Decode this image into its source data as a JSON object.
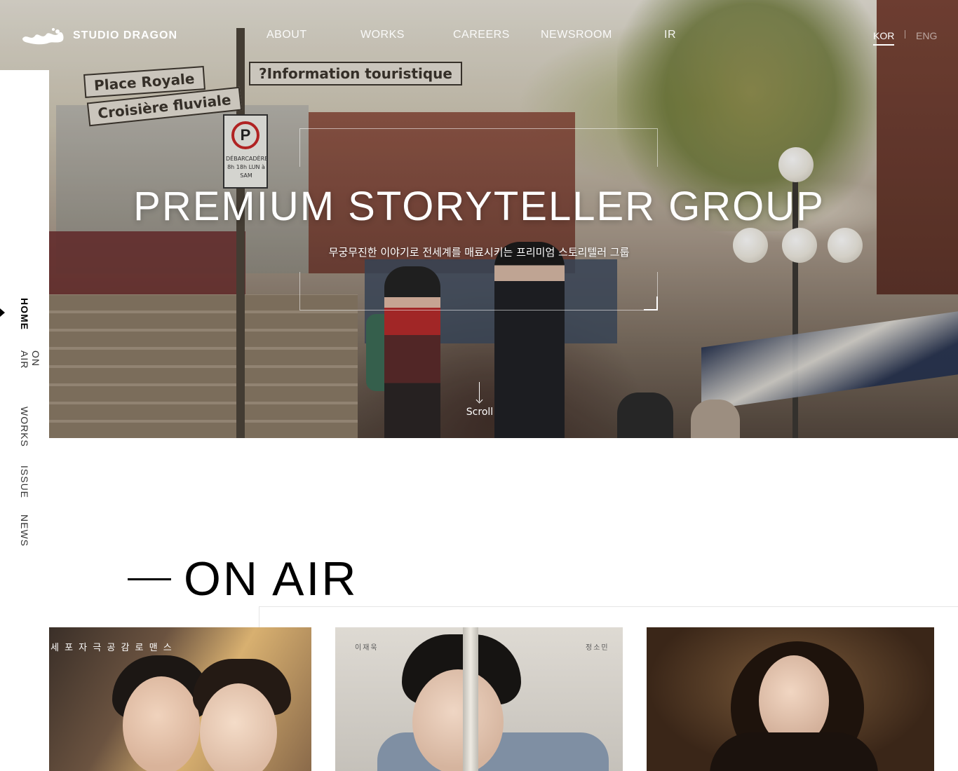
{
  "brand": {
    "name": "STUDIO DRAGON",
    "logo_mark": "dragon-logo-mark"
  },
  "gnb": {
    "items": [
      {
        "label": "ABOUT"
      },
      {
        "label": "WORKS"
      },
      {
        "label": "CAREERS"
      },
      {
        "label": "NEWSROOM"
      },
      {
        "label": "IR"
      }
    ]
  },
  "language": {
    "active": "KOR",
    "kor": "KOR",
    "eng": "ENG"
  },
  "hero": {
    "title": "PREMIUM STORYTELLER GROUP",
    "subtitle": "무궁무진한 이야기로 전세계를 매료시키는 프리미엄 스토리텔러 그룹",
    "scroll_label": "Scroll",
    "scene_signs": {
      "sign_1": "Place Royale",
      "sign_2": "?Information touristique",
      "sign_3": "Croisière fluviale",
      "parking_letter": "P",
      "parking_text": "DÉBARCADÈRE 8h 18h LUN à SAM"
    }
  },
  "side_nav": {
    "items": [
      {
        "label": "HOME",
        "active": true
      },
      {
        "label": "ON AIR",
        "active": false
      },
      {
        "label": "WORKS",
        "active": false
      },
      {
        "label": "ISSUE",
        "active": false
      },
      {
        "label": "NEWS",
        "active": false
      }
    ]
  },
  "on_air": {
    "title": "ON AIR",
    "posters": [
      {
        "tagline": "세 포   자 극   공 감   로 맨 스"
      },
      {
        "left_name": "이재욱",
        "right_name": "정소민"
      },
      {}
    ]
  },
  "colors": {
    "text_on_hero": "#ffffff",
    "heading": "#000000",
    "divider": "#e5e5e5"
  }
}
